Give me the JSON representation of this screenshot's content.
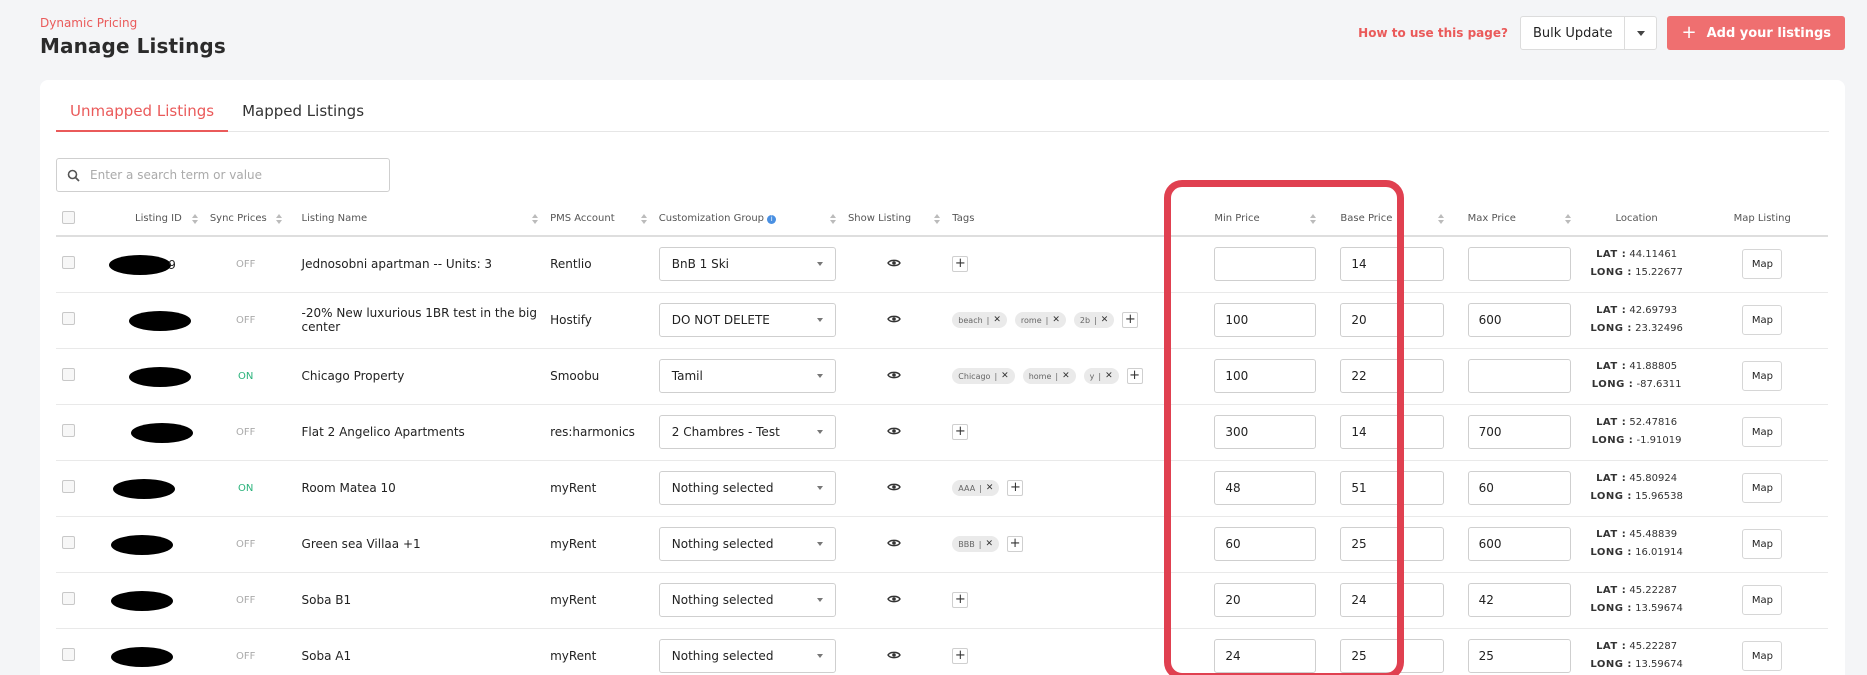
{
  "header": {
    "eyebrow": "Dynamic Pricing",
    "title": "Manage Listings"
  },
  "actions": {
    "help": "How to use this page?",
    "bulk": "Bulk Update",
    "add": "Add your listings"
  },
  "tabs": [
    {
      "label": "Unmapped Listings",
      "active": true
    },
    {
      "label": "Mapped Listings",
      "active": false
    }
  ],
  "search": {
    "placeholder": "Enter a search term or value"
  },
  "columns": {
    "listing_id": "Listing ID",
    "sync": "Sync Prices",
    "name": "Listing Name",
    "pms": "PMS Account",
    "group": "Customization Group",
    "show": "Show Listing",
    "tags": "Tags",
    "min": "Min Price",
    "base": "Base Price",
    "max": "Max Price",
    "location": "Location",
    "map": "Map Listing"
  },
  "rows": [
    {
      "id_tail": "9",
      "sync": "OFF",
      "name": "Jednosobni apartman -- Units: 3",
      "pms": "Rentlio",
      "group": "BnB 1 Ski",
      "tags": [],
      "min": "",
      "base": "14",
      "max": "",
      "lat": "44.11461",
      "long": "15.22677",
      "map": "Map"
    },
    {
      "id_tail": "",
      "sync": "OFF",
      "name": "-20% New luxurious 1BR test in the big center",
      "pms": "Hostify",
      "group": "DO NOT DELETE",
      "tags": [
        "beach",
        "rome",
        "2b"
      ],
      "min": "100",
      "base": "20",
      "max": "600",
      "lat": "42.69793",
      "long": "23.32496",
      "map": "Map"
    },
    {
      "id_tail": "",
      "sync": "ON",
      "name": "Chicago Property",
      "pms": "Smoobu",
      "group": "Tamil",
      "tags": [
        "Chicago",
        "home",
        "y"
      ],
      "min": "100",
      "base": "22",
      "max": "",
      "lat": "41.88805",
      "long": "-87.6311",
      "map": "Map"
    },
    {
      "id_tail": "",
      "sync": "OFF",
      "name": "Flat 2 Angelico Apartments",
      "pms": "res:harmonics",
      "group": "2 Chambres - Test",
      "tags": [],
      "min": "300",
      "base": "14",
      "max": "700",
      "lat": "52.47816",
      "long": "-1.91019",
      "map": "Map"
    },
    {
      "id_tail": "",
      "sync": "ON",
      "name": "Room Matea 10",
      "pms": "myRent",
      "group": "Nothing selected",
      "tags": [
        "AAA"
      ],
      "min": "48",
      "base": "51",
      "max": "60",
      "lat": "45.80924",
      "long": "15.96538",
      "map": "Map"
    },
    {
      "id_tail": "",
      "sync": "OFF",
      "name": "Green sea Villaa +1",
      "pms": "myRent",
      "group": "Nothing selected",
      "tags": [
        "BBB"
      ],
      "min": "60",
      "base": "25",
      "max": "600",
      "lat": "45.48839",
      "long": "16.01914",
      "map": "Map"
    },
    {
      "id_tail": "",
      "sync": "OFF",
      "name": "Soba B1",
      "pms": "myRent",
      "group": "Nothing selected",
      "tags": [],
      "min": "20",
      "base": "24",
      "max": "42",
      "lat": "45.22287",
      "long": "13.59674",
      "map": "Map"
    },
    {
      "id_tail": "",
      "sync": "OFF",
      "name": "Soba A1",
      "pms": "myRent",
      "group": "Nothing selected",
      "tags": [],
      "min": "24",
      "base": "25",
      "max": "25",
      "lat": "45.22287",
      "long": "13.59674",
      "map": "Map"
    }
  ],
  "labels": {
    "lat": "LAT :",
    "long": "LONG :"
  },
  "colors": {
    "accent": "#ea5a5a",
    "button": "#ef6f70",
    "on": "#2ab27b",
    "highlight": "#e04050"
  }
}
